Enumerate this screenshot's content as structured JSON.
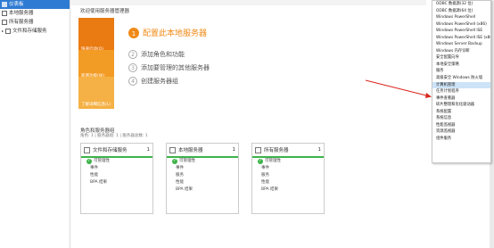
{
  "sidebar": {
    "items": [
      {
        "label": "仪表板",
        "active": true
      },
      {
        "label": "本地服务器",
        "active": false
      },
      {
        "label": "所有服务器",
        "active": false
      },
      {
        "label": "文件和存储服务",
        "active": false
      }
    ]
  },
  "main": {
    "title": "欢迎使用服务器管理器",
    "quick_start": [
      "快速启动(Q)",
      "新增功能(W)",
      "了解详细信息(L)"
    ],
    "steps": [
      {
        "num": "1",
        "label": "配置此本地服务器"
      },
      {
        "num": "2",
        "label": "添加角色和功能"
      },
      {
        "num": "3",
        "label": "添加要管理的其他服务器"
      },
      {
        "num": "4",
        "label": "创建服务器组"
      }
    ]
  },
  "roles": {
    "title": "角色和服务器组",
    "subtitle": "角色: 1 | 服务器组: 1 | 服务器总数: 1",
    "cards": [
      {
        "name": "文件和存储服务",
        "count": "1",
        "status": "可管理性",
        "rows": [
          "事件",
          "性能",
          "BPA 结果"
        ]
      },
      {
        "name": "本地服务器",
        "count": "1",
        "status": "可管理性",
        "rows": [
          "事件",
          "服务",
          "性能",
          "BPA 结果"
        ]
      },
      {
        "name": "所有服务器",
        "count": "1",
        "status": "可管理性",
        "rows": [
          "事件",
          "服务",
          "性能",
          "BPA 结果"
        ]
      }
    ]
  },
  "menu": {
    "items": [
      "ODBC 数据源(32 位)",
      "ODBC 数据源(64 位)",
      "Windows PowerShell",
      "Windows PowerShell (x86)",
      "Windows PowerShell ISE",
      "Windows PowerShell ISE (x86)",
      "Windows Server Backup",
      "Windows 内存诊断",
      "安全配置向导",
      "本地安全策略",
      "服务",
      "高级安全 Windows 防火墙",
      "计算机管理",
      "任务计划程序",
      "事件查看器",
      "碎片整理和优化驱动器",
      "系统配置",
      "系统信息",
      "性能监视器",
      "资源监视器",
      "组件服务"
    ],
    "highlighted_index": 12
  },
  "colors": {
    "accent_blue": "#2e7bd3",
    "orange": "#f08a16",
    "green": "#3db349",
    "arrow_red": "#d9261c"
  }
}
